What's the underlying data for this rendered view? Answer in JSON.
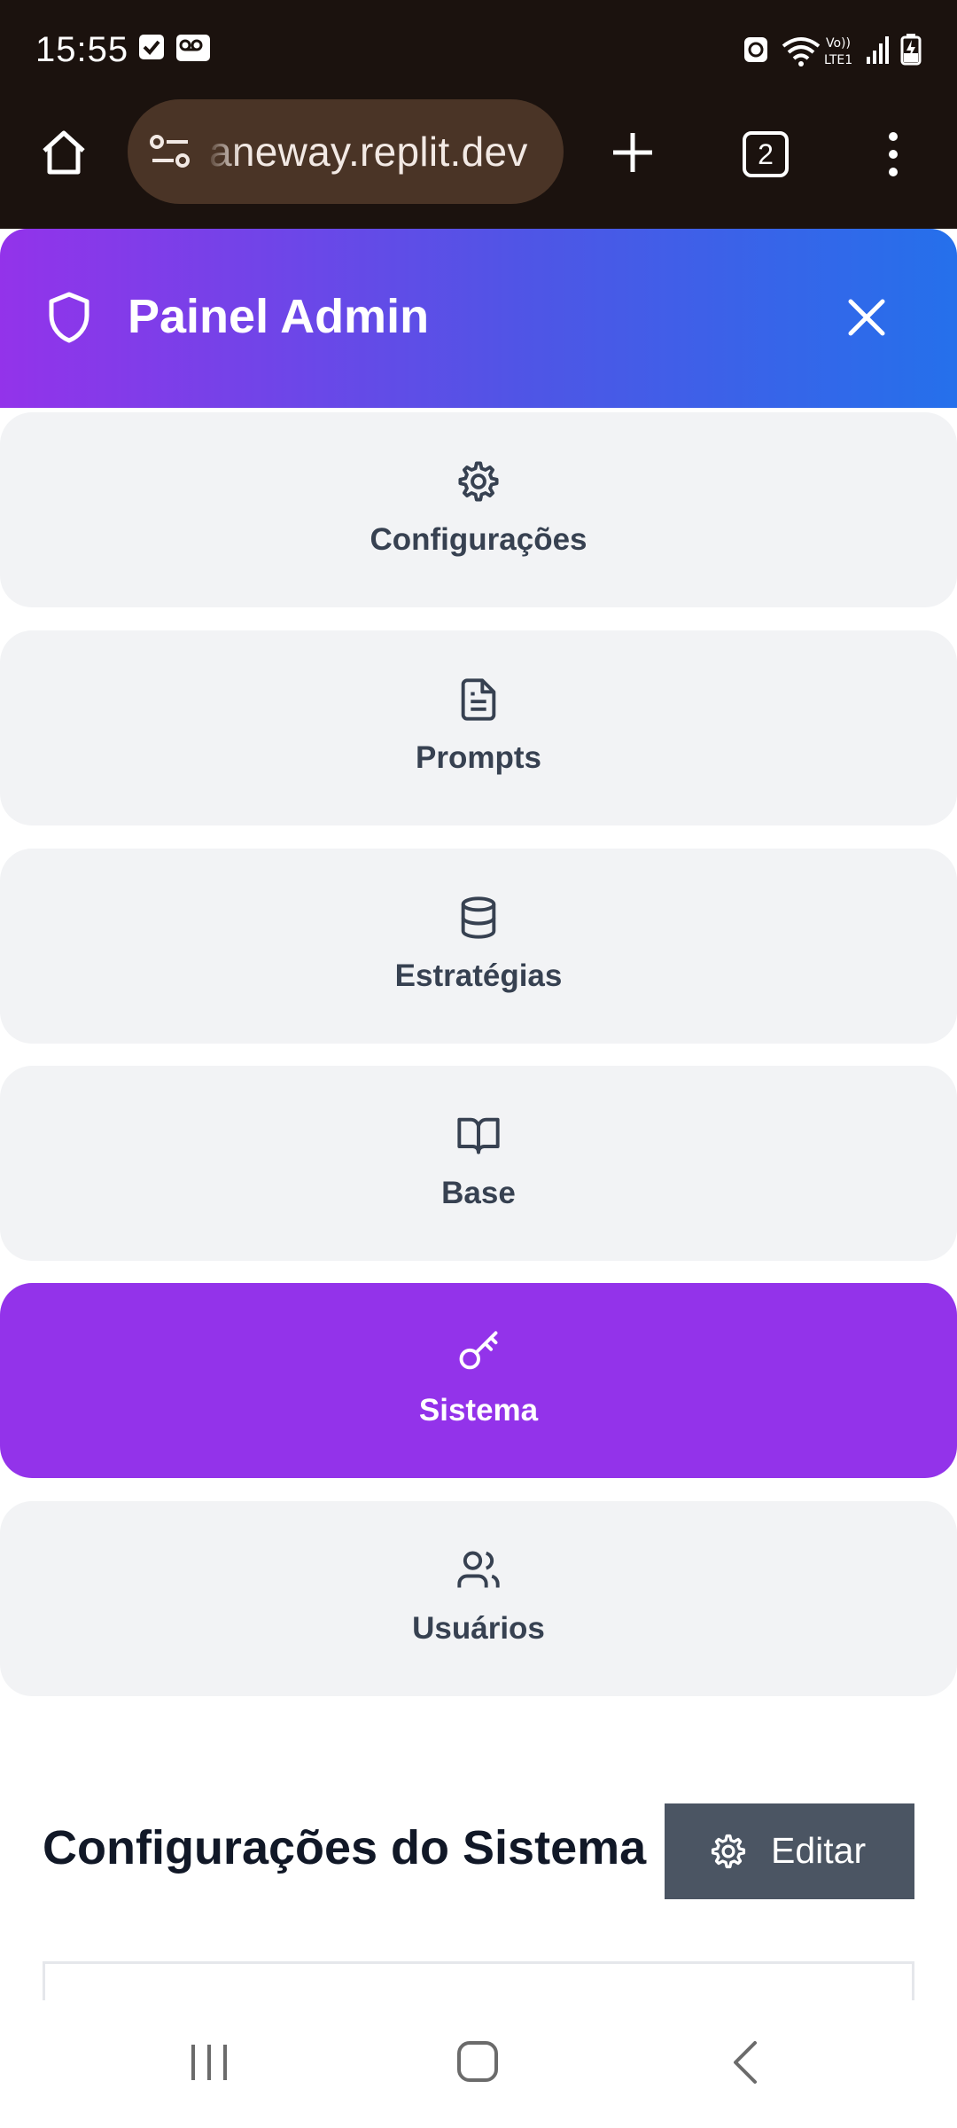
{
  "status_bar": {
    "time": "15:55"
  },
  "browser": {
    "url": "aneway.replit.dev",
    "tab_count": "2"
  },
  "admin": {
    "title": "Painel Admin"
  },
  "nav": {
    "items": [
      {
        "label": "Configurações",
        "icon": "gear-icon"
      },
      {
        "label": "Prompts",
        "icon": "document-icon"
      },
      {
        "label": "Estratégias",
        "icon": "database-icon"
      },
      {
        "label": "Base",
        "icon": "book-icon"
      },
      {
        "label": "Sistema",
        "icon": "key-icon",
        "active": true
      },
      {
        "label": "Usuários",
        "icon": "users-icon"
      }
    ]
  },
  "section": {
    "title": "Configurações do Sistema",
    "edit_label": "Editar"
  },
  "colors": {
    "accent": "#9333ea",
    "header_gradient_start": "#9333ea",
    "header_gradient_end": "#2570eb",
    "edit_button": "#4b5563"
  }
}
